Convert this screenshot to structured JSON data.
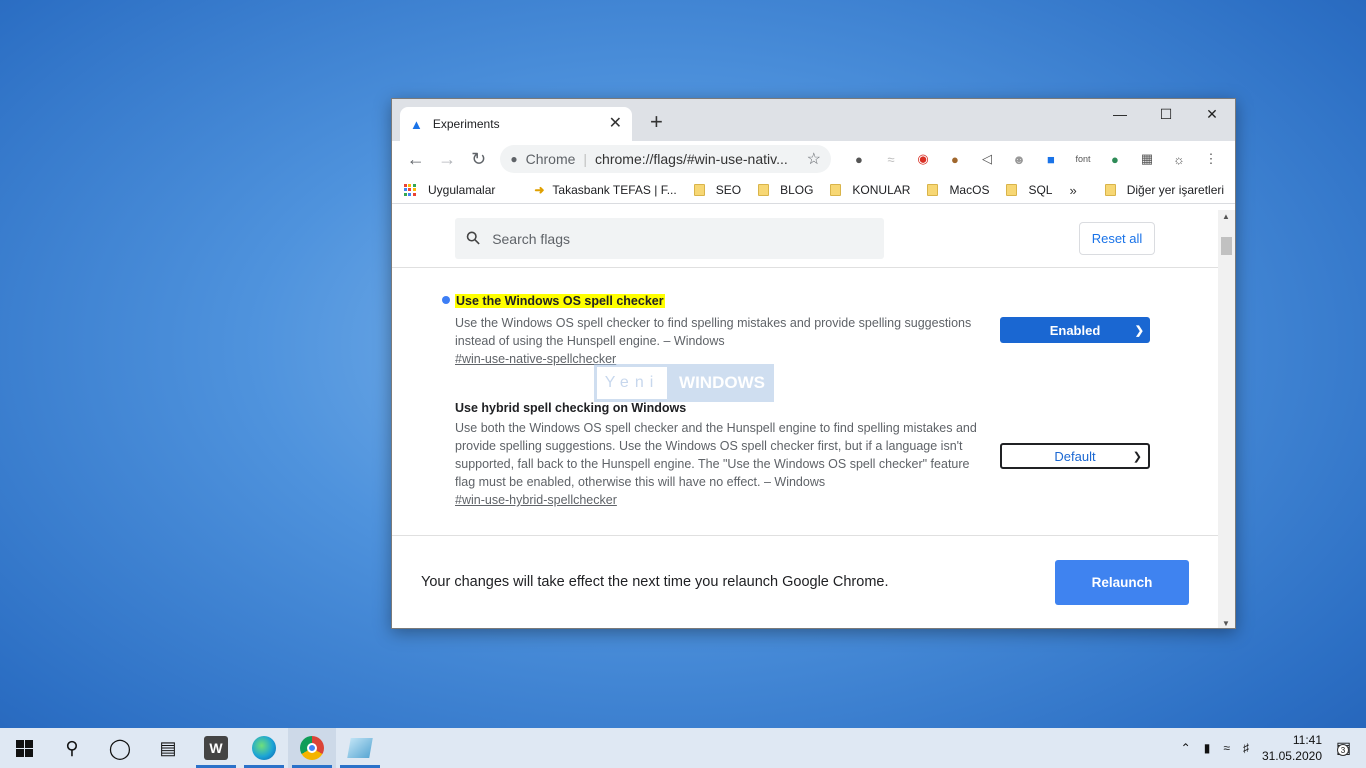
{
  "tab": {
    "title": "Experiments"
  },
  "toolbar": {
    "site_label": "Chrome",
    "url": "chrome://flags/#win-use-nativ...",
    "ext_font_label": "font"
  },
  "bookmarks": {
    "apps_label": "Uygulamalar",
    "items": [
      "Takasbank TEFAS | F...",
      "SEO",
      "BLOG",
      "KONULAR",
      "MacOS",
      "SQL"
    ],
    "other_label": "Diğer yer işaretleri"
  },
  "flags_page": {
    "search_placeholder": "Search flags",
    "reset_label": "Reset all",
    "flags": [
      {
        "title": "Use the Windows OS spell checker",
        "description": "Use the Windows OS spell checker to find spelling mistakes and provide spelling suggestions instead of using the Hunspell engine. – Windows",
        "link": "#win-use-native-spellchecker",
        "value": "Enabled"
      },
      {
        "title": "Use hybrid spell checking on Windows",
        "description": "Use both the Windows OS spell checker and the Hunspell engine to find spelling mistakes and provide spelling suggestions. Use the Windows OS spell checker first, but if a language isn't supported, fall back to the Hunspell engine. The \"Use the Windows OS spell checker\" feature flag must be enabled, otherwise this will have no effect. – Windows",
        "link": "#win-use-hybrid-spellchecker",
        "value": "Default"
      }
    ],
    "relaunch_message": "Your changes will take effect the next time you relaunch Google Chrome.",
    "relaunch_label": "Relaunch"
  },
  "watermark": {
    "left": "Yeni",
    "right": "WINDOWS"
  },
  "taskbar": {
    "time": "11:41",
    "date": "31.05.2020",
    "notification_count": "3"
  },
  "colors": {
    "accent": "#1a67d2",
    "relaunch": "#3f83f0",
    "highlight": "#ffff00"
  }
}
